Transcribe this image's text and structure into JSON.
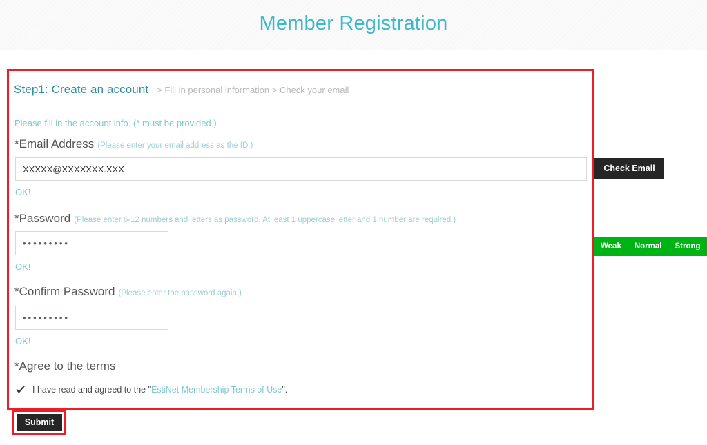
{
  "header": {
    "title": "Member Registration",
    "title_color": "#3bb8c9"
  },
  "form": {
    "steps": {
      "current": "Step1: Create an account",
      "rest": "> Fill in personal information > Check your email"
    },
    "note": "Please fill in the account info. (* must be provided.)",
    "highlight_color": "#ee1c25",
    "email": {
      "label": "*Email Address",
      "hint": "(Please enter your email address as the ID.)",
      "value": "XXXXX@XXXXXXX.XXX",
      "placeholder": "",
      "status": "OK!",
      "button_label": "Check Email"
    },
    "password": {
      "label": "*Password",
      "hint": "(Please enter 6-12 numbers and letters as password. At least 1 uppercase letter and 1 number are required.)",
      "value": "•••••••••",
      "placeholder": "",
      "status": "OK!",
      "strength": {
        "segments": [
          {
            "label": "Weak",
            "color": "#00b315"
          },
          {
            "label": "Normal",
            "color": "#00b315"
          },
          {
            "label": "Strong",
            "color": "#00b315"
          }
        ]
      }
    },
    "confirm_password": {
      "label": "*Confirm Password",
      "hint": "(Please enter the password again.)",
      "value": "•••••••••",
      "placeholder": "",
      "status": "OK!"
    },
    "terms": {
      "label": "*Agree to the terms",
      "checkbox_checked": true,
      "text_before": "I have read and agreed to the \"",
      "link_text": "EstiNet Membership Terms of Use",
      "text_after": "\"."
    },
    "submit_label": "Submit"
  }
}
